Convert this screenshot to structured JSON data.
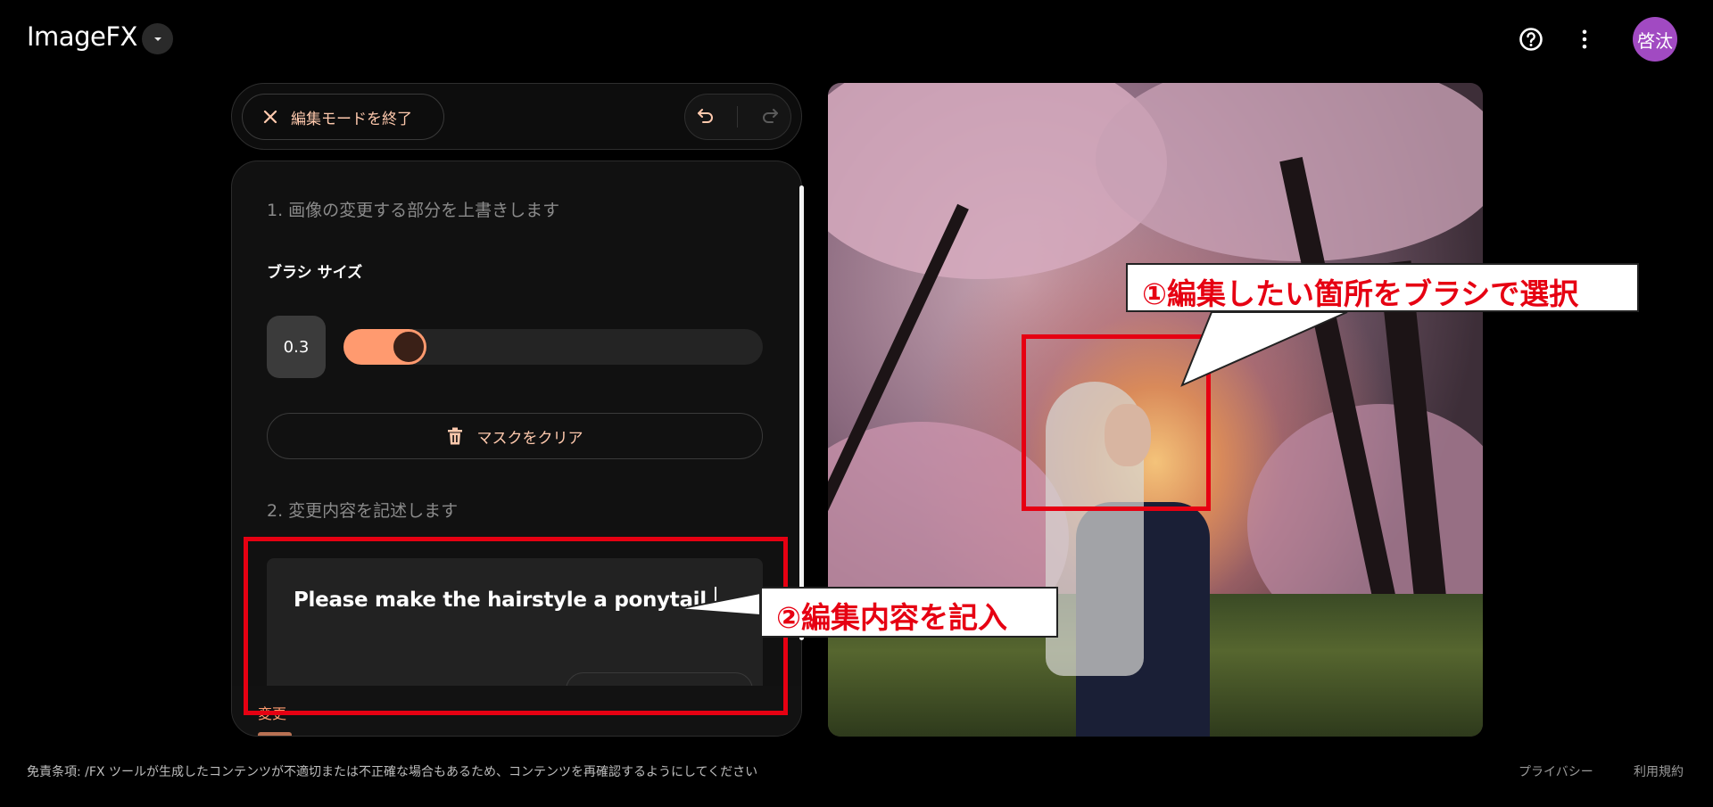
{
  "header": {
    "brand": "ImageFX",
    "help_icon": "help-circle-icon",
    "more_icon": "more-vertical-icon",
    "avatar_text": "啓汰"
  },
  "toolbar": {
    "exit_label": "編集モードを終了",
    "undo_icon": "undo-icon",
    "redo_icon": "redo-icon"
  },
  "panel": {
    "step1": "1. 画像の変更する部分を上書きします",
    "brush_label": "ブラシ サイズ",
    "brush_value": "0.3",
    "brush_level": 0.3,
    "clear_label": "マスクをクリア",
    "step2": "2. 変更内容を記述します",
    "prompt_value": "Please make the hairstyle a ponytail.",
    "change_label": "変更"
  },
  "annotations": {
    "callout1": "①編集したい箇所をブラシで選択",
    "callout2": "②編集内容を記入"
  },
  "footer": {
    "disclaimer": "免責条項: /FX ツールが生成したコンテンツが不適切または不正確な場合もあるため、コンテンツを再確認するようにしてください",
    "privacy": "プライバシー",
    "terms": "利用規約"
  },
  "colors": {
    "accent": "#ff9a6f",
    "annotation_red": "#e60012",
    "avatar": "#a14ac2"
  }
}
